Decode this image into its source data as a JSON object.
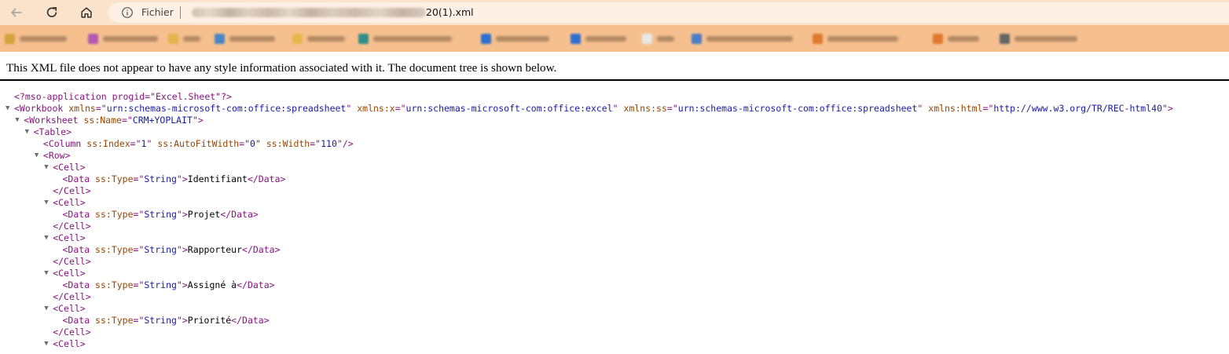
{
  "toolbar": {
    "scheme_label": "Fichier",
    "url_tail": "20(1).xml"
  },
  "bookmarks": [
    {
      "icon_color": "#d4a33c"
    },
    {
      "icon_color": "#b05bb0"
    },
    {
      "icon_color": "#e2b64a"
    },
    {
      "icon_color": "#4a86c6"
    },
    {
      "icon_color": "#e3b84b"
    },
    {
      "icon_color": "#2f8f87"
    },
    {
      "icon_color": "#2f6fd0"
    },
    {
      "icon_color": "#2f6fd0"
    },
    {
      "icon_color": "#e7e7e7"
    },
    {
      "icon_color": "#4a7cc8"
    },
    {
      "icon_color": "#e07a2e"
    },
    {
      "icon_color": "#e07a2e"
    },
    {
      "icon_color": "#666666"
    }
  ],
  "notice": "This XML file does not appear to have any style information associated with it. The document tree is shown below.",
  "tree": {
    "pi": "<?mso-application progid=\"Excel.Sheet\"?>",
    "workbook_open": {
      "name": "Workbook",
      "attrs": [
        {
          "n": "xmlns",
          "v": "urn:schemas-microsoft-com:office:spreadsheet"
        },
        {
          "n": "xmlns:x",
          "v": "urn:schemas-microsoft-com:office:excel"
        },
        {
          "n": "xmlns:ss",
          "v": "urn:schemas-microsoft-com:office:spreadsheet"
        },
        {
          "n": "xmlns:html",
          "v": "http://www.w3.org/TR/REC-html40"
        }
      ]
    },
    "worksheet_open": {
      "name": "Worksheet",
      "attrs": [
        {
          "n": "ss:Name",
          "v": "CRM+YOPLAIT"
        }
      ]
    },
    "table_open": {
      "name": "Table"
    },
    "column": {
      "name": "Column",
      "attrs": [
        {
          "n": "ss:Index",
          "v": "1"
        },
        {
          "n": "ss:AutoFitWidth",
          "v": "0"
        },
        {
          "n": "ss:Width",
          "v": "110"
        }
      ]
    },
    "row_open": {
      "name": "Row"
    },
    "cells": [
      {
        "type": "String",
        "text": "Identifiant"
      },
      {
        "type": "String",
        "text": "Projet"
      },
      {
        "type": "String",
        "text": "Rapporteur"
      },
      {
        "type": "String",
        "text": "Assigné à"
      },
      {
        "type": "String",
        "text": "Priorité"
      }
    ]
  }
}
